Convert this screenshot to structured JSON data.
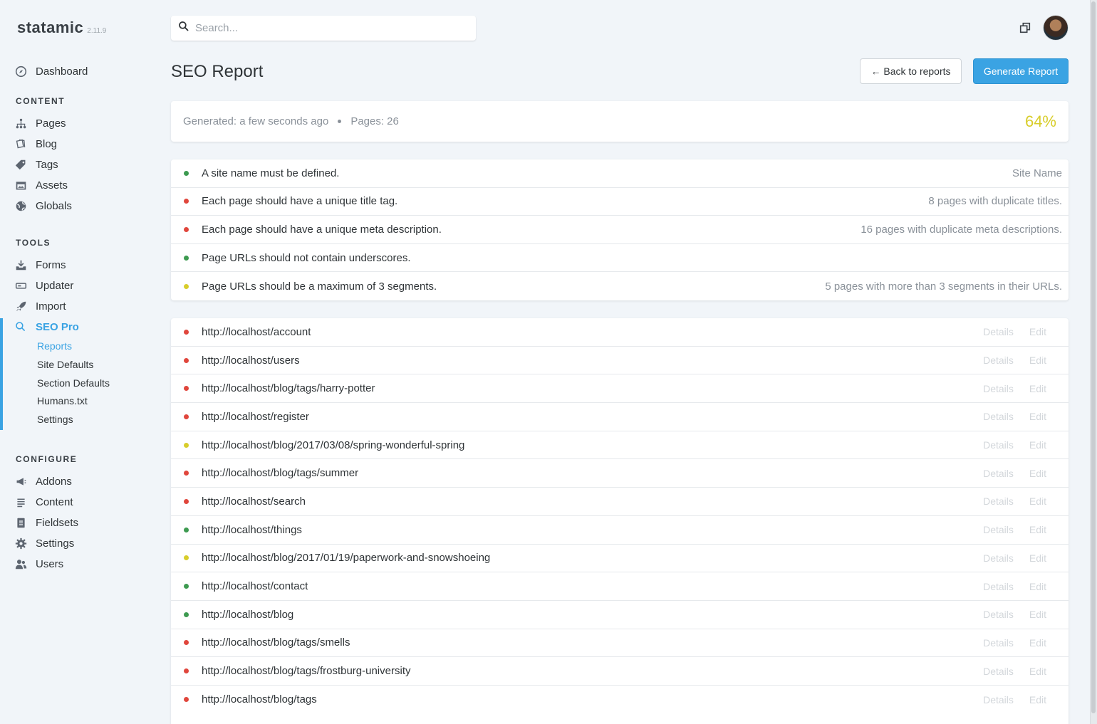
{
  "brand": {
    "name": "statamic",
    "version": "2.11.9"
  },
  "search": {
    "placeholder": "Search..."
  },
  "nav": {
    "dashboard": "Dashboard",
    "content_head": "CONTENT",
    "content_items": [
      "Pages",
      "Blog",
      "Tags",
      "Assets",
      "Globals"
    ],
    "tools_head": "TOOLS",
    "tools_items": [
      "Forms",
      "Updater",
      "Import",
      "SEO Pro"
    ],
    "seo_sub": [
      "Reports",
      "Site Defaults",
      "Section Defaults",
      "Humans.txt",
      "Settings"
    ],
    "configure_head": "CONFIGURE",
    "configure_items": [
      "Addons",
      "Content",
      "Fieldsets",
      "Settings",
      "Users"
    ]
  },
  "header": {
    "title": "SEO Report",
    "back_label": "← Back to reports",
    "generate_label": "Generate Report"
  },
  "summary": {
    "generated": "Generated: a few seconds ago",
    "pages": "Pages: 26",
    "score": "64%",
    "score_color": "#d8cd2b"
  },
  "rules": [
    {
      "status": "green",
      "text": "A site name must be defined.",
      "result": "Site Name"
    },
    {
      "status": "red",
      "text": "Each page should have a unique title tag.",
      "result": "8 pages with duplicate titles."
    },
    {
      "status": "red",
      "text": "Each page should have a unique meta description.",
      "result": "16 pages with duplicate meta descriptions."
    },
    {
      "status": "green",
      "text": "Page URLs should not contain underscores.",
      "result": ""
    },
    {
      "status": "yellow",
      "text": "Page URLs should be a maximum of 3 segments.",
      "result": "5 pages with more than 3 segments in their URLs."
    }
  ],
  "page_actions": {
    "details": "Details",
    "edit": "Edit"
  },
  "pages": [
    {
      "status": "red",
      "url": "http://localhost/account"
    },
    {
      "status": "red",
      "url": "http://localhost/users"
    },
    {
      "status": "red",
      "url": "http://localhost/blog/tags/harry-potter"
    },
    {
      "status": "red",
      "url": "http://localhost/register"
    },
    {
      "status": "yellow",
      "url": "http://localhost/blog/2017/03/08/spring-wonderful-spring"
    },
    {
      "status": "red",
      "url": "http://localhost/blog/tags/summer"
    },
    {
      "status": "red",
      "url": "http://localhost/search"
    },
    {
      "status": "green",
      "url": "http://localhost/things"
    },
    {
      "status": "yellow",
      "url": "http://localhost/blog/2017/01/19/paperwork-and-snowshoeing"
    },
    {
      "status": "green",
      "url": "http://localhost/contact"
    },
    {
      "status": "green",
      "url": "http://localhost/blog"
    },
    {
      "status": "red",
      "url": "http://localhost/blog/tags/smells"
    },
    {
      "status": "red",
      "url": "http://localhost/blog/tags/frostburg-university"
    },
    {
      "status": "red",
      "url": "http://localhost/blog/tags"
    }
  ],
  "colors": {
    "accent": "#3aa3e3",
    "ok": "#3d9a50",
    "error": "#e0463c",
    "warning": "#d8cd2b"
  }
}
